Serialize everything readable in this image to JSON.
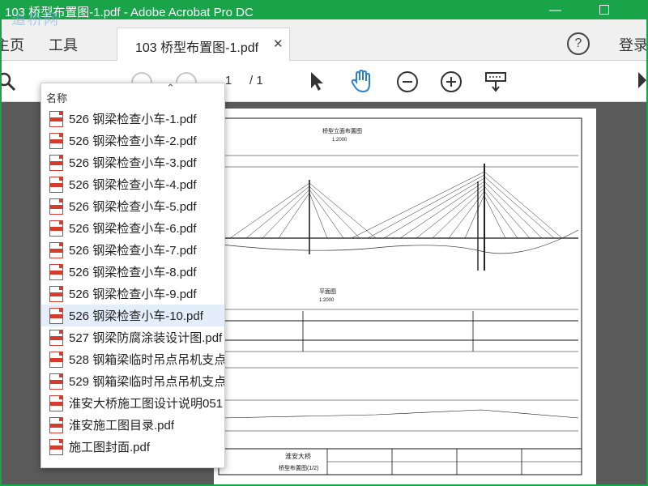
{
  "window": {
    "title": "103 桥型布置图-1.pdf - Adobe Acrobat Pro DC"
  },
  "tabs": {
    "home": "主页",
    "tools": "工具",
    "document": "103 桥型布置图-1.pdf",
    "signin": "登录"
  },
  "toolbar": {
    "page_current": "1",
    "page_total": "/ 1"
  },
  "file_popup": {
    "header": "名称",
    "items": [
      "526 钢梁检查小车-1.pdf",
      "526 钢梁检查小车-2.pdf",
      "526 钢梁检查小车-3.pdf",
      "526 钢梁检查小车-4.pdf",
      "526 钢梁检查小车-5.pdf",
      "526 钢梁检查小车-6.pdf",
      "526 钢梁检查小车-7.pdf",
      "526 钢梁检查小车-8.pdf",
      "526 钢梁检查小车-9.pdf",
      "526 钢梁检查小车-10.pdf",
      "527 钢梁防腐涂装设计图.pdf",
      "528 钢箱梁临时吊点吊机支点",
      "529 钢箱梁临时吊点吊机支点",
      "淮安大桥施工图设计说明051",
      "淮安施工图目录.pdf",
      "施工图封面.pdf"
    ],
    "selected_index": 9
  },
  "drawing": {
    "elevation_title": "桥型立面布置图",
    "elevation_scale": "1:2000",
    "plan_title": "平面图",
    "plan_scale": "1:2000",
    "block_title": "淮安大桥",
    "block_subtitle": "桥型布置图(1/2)"
  },
  "watermark": "道桥网",
  "colors": {
    "accent": "#1aa44a",
    "pdf_red": "#d43c2e",
    "selection": "#e4eefa"
  }
}
